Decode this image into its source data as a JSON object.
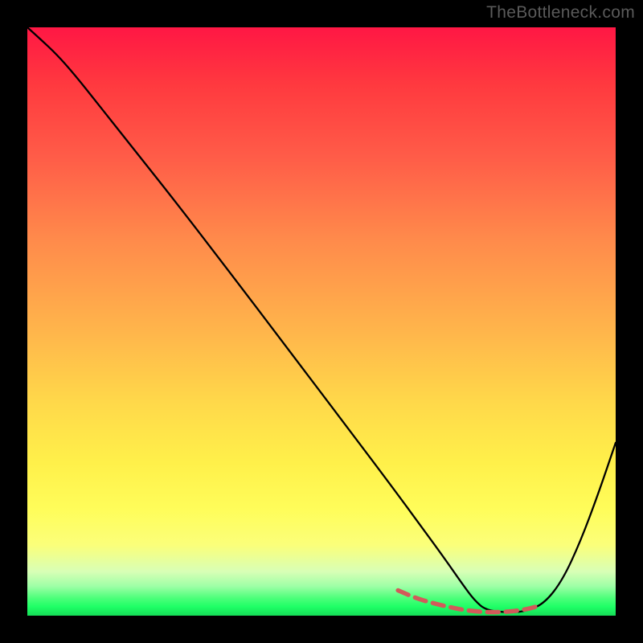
{
  "watermark": "TheBottleneck.com",
  "chart_data": {
    "type": "line",
    "title": "",
    "xlabel": "",
    "ylabel": "",
    "xlim": [
      0,
      100
    ],
    "ylim": [
      0,
      100
    ],
    "series": [
      {
        "name": "black-curve",
        "color": "#000000",
        "stroke_width": 2.3,
        "x": [
          0,
          2,
          5,
          8,
          12,
          18,
          25,
          35,
          45,
          55,
          62,
          67,
          71,
          74,
          76,
          78,
          82,
          85,
          88,
          91,
          94,
          97,
          100
        ],
        "values": [
          100,
          98.2,
          95.4,
          92.0,
          87.0,
          79.4,
          70.6,
          57.6,
          44.4,
          31.2,
          21.9,
          15.1,
          9.6,
          5.3,
          2.6,
          0.9,
          0.5,
          0.8,
          2.2,
          6.1,
          12.6,
          20.6,
          29.4
        ]
      },
      {
        "name": "red-dashed-trough",
        "color": "#d25a5a",
        "stroke_width": 5.5,
        "dash": [
          14,
          9
        ],
        "x": [
          63,
          66,
          69,
          72,
          74,
          76,
          78,
          80,
          82,
          84,
          85.5,
          87
        ],
        "values": [
          4.3,
          3.0,
          2.1,
          1.4,
          1.0,
          0.75,
          0.6,
          0.6,
          0.7,
          0.95,
          1.25,
          1.7
        ]
      }
    ]
  }
}
